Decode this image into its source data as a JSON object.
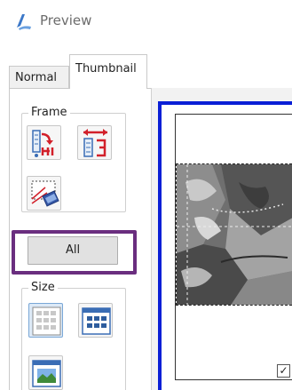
{
  "window": {
    "title": "Preview",
    "icon": "preview-app-icon"
  },
  "tabs": [
    {
      "label": "Normal",
      "selected": false
    },
    {
      "label": "Thumbnail",
      "selected": true
    }
  ],
  "frame_group": {
    "label": "Frame",
    "buttons": [
      {
        "icon": "frame-vertical-arrange-icon"
      },
      {
        "icon": "frame-horizontal-arrange-icon"
      },
      {
        "icon": "frame-select-area-icon"
      }
    ],
    "all_label": "All"
  },
  "size_group": {
    "label": "Size",
    "buttons": [
      {
        "icon": "thumbnail-small-grid-icon",
        "selected": true
      },
      {
        "icon": "thumbnail-medium-grid-icon",
        "selected": false
      },
      {
        "icon": "thumbnail-large-icon",
        "selected": false
      }
    ]
  },
  "preview": {
    "checkbox_checked": true,
    "checkbox_mark": "✓"
  },
  "colors": {
    "highlight": "#6a2e7f",
    "preview_border": "#0a1fd6",
    "accent_red": "#d2202a"
  }
}
